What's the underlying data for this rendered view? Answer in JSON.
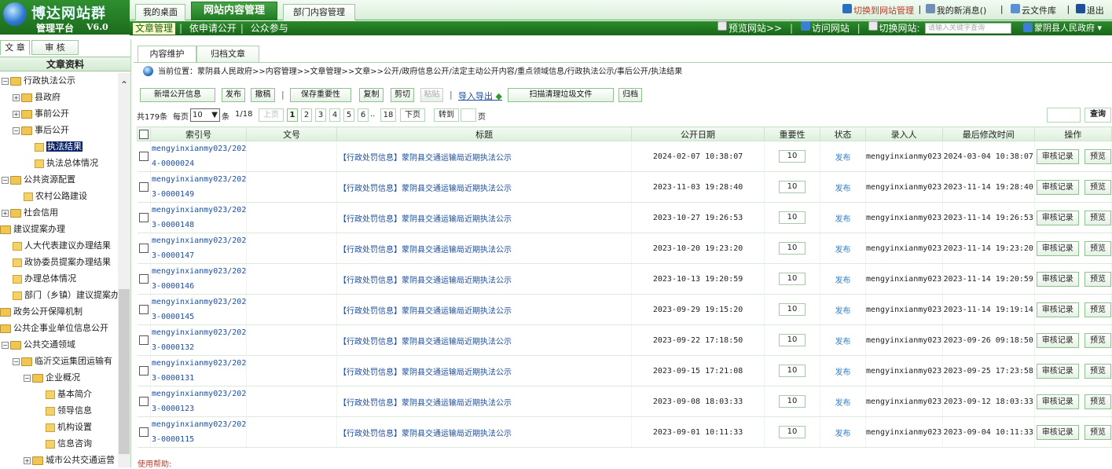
{
  "app": {
    "logo_title": "博达网站群",
    "logo_sub": "管理平台",
    "version": "V6.0",
    "main_tabs": [
      "我的桌面",
      "网站内容管理",
      "部门内容管理"
    ],
    "top_links": {
      "switch_site": "切换到网站管理",
      "messages": "我的新消息()",
      "cloud": "云文件库",
      "logout": "退出"
    },
    "sub_nav": [
      "文章管理",
      "依申请公开",
      "公众参与"
    ],
    "sub_right": {
      "preview": "预览网站>>",
      "visit": "访问网站",
      "switch": "切换网站:",
      "search_placeholder": "请输入关键字查询",
      "site": "蒙阴县人民政府"
    },
    "accent": "#1f7a1f"
  },
  "sidebar": {
    "tabs": [
      "文 章",
      "审 核"
    ],
    "header": "文章资料",
    "tree": [
      {
        "label": "行政执法公示"
      },
      {
        "label": "县政府"
      },
      {
        "label": "事前公开"
      },
      {
        "label": "事后公开"
      },
      {
        "label": "执法结果"
      },
      {
        "label": "执法总体情况"
      },
      {
        "label": "公共资源配置"
      },
      {
        "label": "农村公路建设"
      },
      {
        "label": "社会信用"
      },
      {
        "label": "建议提案办理"
      },
      {
        "label": "人大代表建议办理结果"
      },
      {
        "label": "政协委员提案办理结果"
      },
      {
        "label": "办理总体情况"
      },
      {
        "label": "部门（乡镇）建议提案办理"
      },
      {
        "label": "政务公开保障机制"
      },
      {
        "label": "公共企事业单位信息公开"
      },
      {
        "label": "公共交通领域"
      },
      {
        "label": "临沂交运集团运输有"
      },
      {
        "label": "企业概况"
      },
      {
        "label": "基本简介"
      },
      {
        "label": "领导信息"
      },
      {
        "label": "机构设置"
      },
      {
        "label": "信息咨询"
      },
      {
        "label": "城市公共交通运营"
      }
    ]
  },
  "main": {
    "tabs": [
      "内容维护",
      "归档文章"
    ],
    "breadcrumb": "当前位置：蒙阴县人民政府>>内容管理>>文章管理>>文章>>公开/政府信息公开/法定主动公开内容/重点领域信息/行政执法公示/事后公开/执法结果",
    "toolbar": [
      "新增公开信息",
      "发布",
      "撤稿",
      "保存重要性",
      "复制",
      "剪切",
      "粘贴",
      "导入导出",
      "扫描清理垃圾文件",
      "归档"
    ],
    "pager": {
      "total": "共179条",
      "per_page_label": "每页",
      "per_page": "10",
      "unit": "条",
      "page_of": "1/18",
      "prev": "上页",
      "pages": [
        "1",
        "2",
        "3",
        "4",
        "5",
        "6",
        "..",
        "18"
      ],
      "next": "下页",
      "goto": "转到",
      "page_unit": "页",
      "query": "查询"
    },
    "columns": [
      "索引号",
      "文号",
      "标题",
      "公开日期",
      "重要性",
      "状态",
      "录入人",
      "最后修改时间",
      "操作"
    ],
    "rows": [
      {
        "idx1": "mengyinxianmy023/202",
        "idx2": "4-0000024",
        "title": "【行政处罚信息】蒙阴县交通运输局近期执法公示",
        "date": "2024-02-07 10:38:07",
        "imp": "10",
        "status": "发布",
        "user": "mengyinxianmy023",
        "mtime": "2024-03-04 10:38:07"
      },
      {
        "idx1": "mengyinxianmy023/202",
        "idx2": "3-0000149",
        "title": "【行政处罚信息】蒙阴县交通运输局近期执法公示",
        "date": "2023-11-03 19:28:40",
        "imp": "10",
        "status": "发布",
        "user": "mengyinxianmy023",
        "mtime": "2023-11-14 19:28:40"
      },
      {
        "idx1": "mengyinxianmy023/202",
        "idx2": "3-0000148",
        "title": "【行政处罚信息】蒙阴县交通运输局近期执法公示",
        "date": "2023-10-27 19:26:53",
        "imp": "10",
        "status": "发布",
        "user": "mengyinxianmy023",
        "mtime": "2023-11-14 19:26:53"
      },
      {
        "idx1": "mengyinxianmy023/202",
        "idx2": "3-0000147",
        "title": "【行政处罚信息】蒙阴县交通运输局近期执法公示",
        "date": "2023-10-20 19:23:20",
        "imp": "10",
        "status": "发布",
        "user": "mengyinxianmy023",
        "mtime": "2023-11-14 19:23:20"
      },
      {
        "idx1": "mengyinxianmy023/202",
        "idx2": "3-0000146",
        "title": "【行政处罚信息】蒙阴县交通运输局近期执法公示",
        "date": "2023-10-13 19:20:59",
        "imp": "10",
        "status": "发布",
        "user": "mengyinxianmy023",
        "mtime": "2023-11-14 19:20:59"
      },
      {
        "idx1": "mengyinxianmy023/202",
        "idx2": "3-0000145",
        "title": "【行政处罚信息】蒙阴县交通运输局近期执法公示",
        "date": "2023-09-29 19:15:20",
        "imp": "10",
        "status": "发布",
        "user": "mengyinxianmy023",
        "mtime": "2023-11-14 19:19:14"
      },
      {
        "idx1": "mengyinxianmy023/202",
        "idx2": "3-0000132",
        "title": "【行政处罚信息】蒙阴县交通运输局近期执法公示",
        "date": "2023-09-22 17:18:50",
        "imp": "10",
        "status": "发布",
        "user": "mengyinxianmy023",
        "mtime": "2023-09-26 09:18:50"
      },
      {
        "idx1": "mengyinxianmy023/202",
        "idx2": "3-0000131",
        "title": "【行政处罚信息】蒙阴县交通运输局近期执法公示",
        "date": "2023-09-15 17:21:08",
        "imp": "10",
        "status": "发布",
        "user": "mengyinxianmy023",
        "mtime": "2023-09-25 17:23:58"
      },
      {
        "idx1": "mengyinxianmy023/202",
        "idx2": "3-0000123",
        "title": "【行政处罚信息】蒙阴县交通运输局近期执法公示",
        "date": "2023-09-08 18:03:33",
        "imp": "10",
        "status": "发布",
        "user": "mengyinxianmy023",
        "mtime": "2023-09-12 18:03:33"
      },
      {
        "idx1": "mengyinxianmy023/202",
        "idx2": "3-0000115",
        "title": "【行政处罚信息】蒙阴县交通运输局近期执法公示",
        "date": "2023-09-01 10:11:33",
        "imp": "10",
        "status": "发布",
        "user": "mengyinxianmy023",
        "mtime": "2023-09-04 10:11:33"
      }
    ],
    "row_actions": [
      "审核记录",
      "预览"
    ],
    "help": "使用帮助:"
  }
}
